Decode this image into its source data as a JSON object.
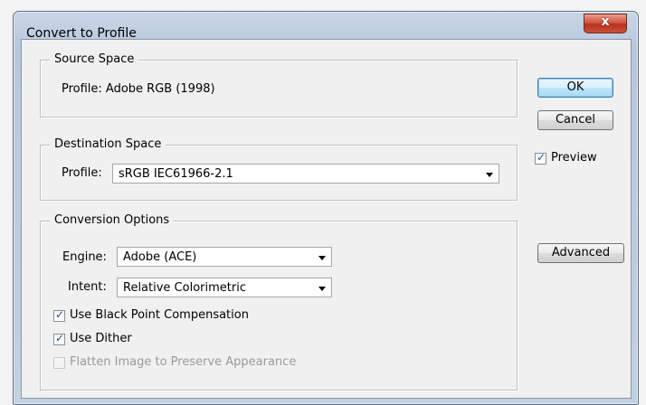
{
  "window": {
    "title": "Convert to Profile",
    "close_glyph": "x"
  },
  "source_space": {
    "legend": "Source Space",
    "profile_text": "Profile:  Adobe RGB (1998)"
  },
  "destination_space": {
    "legend": "Destination Space",
    "profile_label": "Profile:",
    "profile_value": "sRGB IEC61966-2.1"
  },
  "conversion_options": {
    "legend": "Conversion Options",
    "engine_label": "Engine:",
    "engine_value": "Adobe (ACE)",
    "intent_label": "Intent:",
    "intent_value": "Relative Colorimetric",
    "black_point": {
      "label": "Use Black Point Compensation",
      "checked": true
    },
    "dither": {
      "label": "Use Dither",
      "checked": true
    },
    "flatten": {
      "label": "Flatten Image to Preserve Appearance",
      "checked": false,
      "enabled": false
    }
  },
  "buttons": {
    "ok": "OK",
    "cancel": "Cancel",
    "advanced": "Advanced"
  },
  "preview": {
    "label": "Preview",
    "checked": true
  },
  "colors": {
    "default_button_border": "#3c7fb1",
    "close_button": "#c8503a",
    "checkmark": "#2a4f9c"
  }
}
